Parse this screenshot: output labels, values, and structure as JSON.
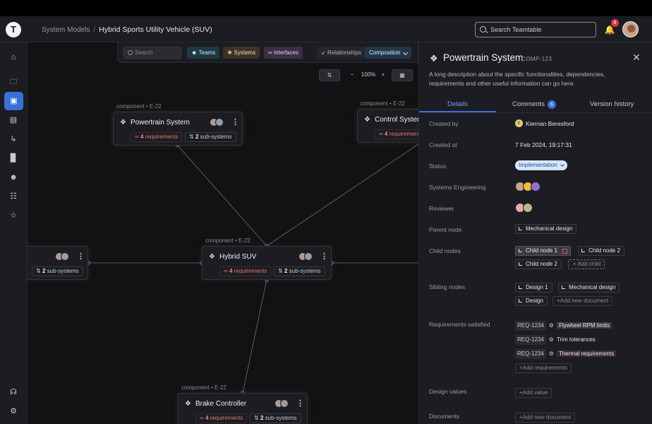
{
  "app": {
    "logo_text": "T"
  },
  "breadcrumb": {
    "parent": "System Models",
    "separator": "/",
    "current": "Hybrid Sports Utility Vehicle (SUV)"
  },
  "topbar": {
    "search_placeholder": "Search Teamtable",
    "notification_count": "8"
  },
  "sidebar": {
    "icons": [
      "home-icon",
      "folder-icon",
      "cube-icon",
      "document-icon",
      "flow-icon",
      "chart-icon",
      "users-icon",
      "list-icon",
      "star-icon",
      "headset-icon",
      "settings-icon"
    ]
  },
  "toolbar": {
    "search_placeholder": "Search",
    "teams": "Teams",
    "systems": "Systems",
    "interfaces": "Interfaces",
    "relationships": "Relationships",
    "composition": "Composition"
  },
  "zoom": {
    "level": "100%",
    "minus": "−",
    "plus": "+"
  },
  "nodes": [
    {
      "kind": "component",
      "code": "E-22",
      "name": "Powertrain System",
      "req_count": "4",
      "req_label": "requirements",
      "sub_count": "2",
      "sub_label": "sub-systems"
    },
    {
      "kind": "component",
      "code": "E-22",
      "name": "Control System",
      "req_count": "4",
      "req_label": "requirements"
    },
    {
      "sub_count": "2",
      "sub_label": "sub-systems"
    },
    {
      "kind": "component",
      "code": "E-22",
      "name": "Hybrid SUV",
      "req_count": "4",
      "req_label": "requirements",
      "sub_count": "2",
      "sub_label": "sub-systems"
    },
    {
      "kind": "component",
      "code": "E-22",
      "name": "Brake Controller",
      "req_count": "4",
      "req_label": "requirements",
      "sub_count": "2",
      "sub_label": "sub-systems"
    }
  ],
  "panel": {
    "title": "Powertrain System",
    "code": "COMP-123",
    "description": "A long description about the specific functionalities, dependencies, requirements and other useful information can go here.",
    "tabs": {
      "details": "Details",
      "comments": "Comments",
      "comments_count": "6",
      "history": "Version history"
    },
    "fields": {
      "created_by": {
        "label": "Created by",
        "value": "Kiernan Beresford",
        "initial": "K"
      },
      "created_at": {
        "label": "Created at",
        "value": "7 Feb 2024, 19:17:31"
      },
      "status": {
        "label": "Status",
        "value": "Implementation"
      },
      "systems_engineering": {
        "label": "Systems Engineering"
      },
      "reviewer": {
        "label": "Reviewer"
      },
      "parent": {
        "label": "Parent node",
        "value": "Mechanical design"
      },
      "children": {
        "label": "Child nodes",
        "items": [
          "Child node 1",
          "Child node 2",
          "Child node 2"
        ],
        "add": "+ Add child"
      },
      "siblings": {
        "label": "Sibling nodes",
        "items": [
          "Design 1",
          "Mechanical design",
          "Design"
        ],
        "add": "+Add new document"
      },
      "requirements": {
        "label": "Requirements satisfied",
        "items": [
          {
            "code": "REQ-1234",
            "name": "Flywheel RPM limits"
          },
          {
            "code": "REQ-1234",
            "name": "Trim tolerances"
          },
          {
            "code": "REQ-1234",
            "name": "Thermal requirements"
          }
        ],
        "add": "+Add requirements"
      },
      "design_values": {
        "label": "Design values",
        "add": "+Add value"
      },
      "documents": {
        "label": "Documents",
        "add": "+Add new document"
      }
    }
  },
  "colors": {
    "accent": "#3a6fd8",
    "danger": "#e0334c",
    "canvas": "#111214",
    "panel": "#1c1d22"
  }
}
